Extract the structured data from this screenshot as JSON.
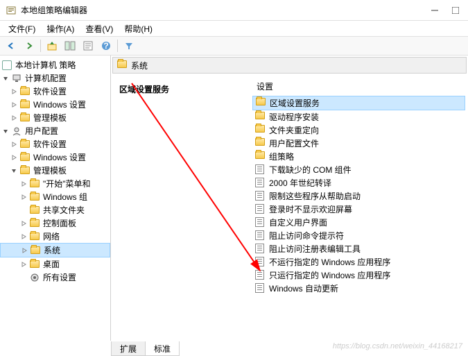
{
  "window": {
    "title": "本地组策略编辑器"
  },
  "menu": {
    "file": "文件(F)",
    "action": "操作(A)",
    "view": "查看(V)",
    "help": "帮助(H)"
  },
  "tree": {
    "root": "本地计算机 策略",
    "computer": "计算机配置",
    "user": "用户配置",
    "software": "软件设置",
    "windows": "Windows 设置",
    "admin": "管理模板",
    "startmenu": "\"开始\"菜单和",
    "wincomp": "Windows 组",
    "sharedfolder": "共享文件夹",
    "controlpanel": "控制面板",
    "network": "网络",
    "system": "系统",
    "desktop": "桌面",
    "allsettings": "所有设置"
  },
  "path": {
    "current": "系统"
  },
  "detail": {
    "heading": "区域设置服务",
    "column": "设置"
  },
  "settings": [
    {
      "label": "区域设置服务",
      "type": "folder",
      "selected": true
    },
    {
      "label": "驱动程序安装",
      "type": "folder"
    },
    {
      "label": "文件夹重定向",
      "type": "folder"
    },
    {
      "label": "用户配置文件",
      "type": "folder"
    },
    {
      "label": "组策略",
      "type": "folder"
    },
    {
      "label": "下载缺少的 COM 组件",
      "type": "policy"
    },
    {
      "label": "2000 年世纪转译",
      "type": "policy"
    },
    {
      "label": "限制这些程序从帮助启动",
      "type": "policy"
    },
    {
      "label": "登录时不显示欢迎屏幕",
      "type": "policy"
    },
    {
      "label": "自定义用户界面",
      "type": "policy"
    },
    {
      "label": "阻止访问命令提示符",
      "type": "policy"
    },
    {
      "label": "阻止访问注册表编辑工具",
      "type": "policy"
    },
    {
      "label": "不运行指定的 Windows 应用程序",
      "type": "policy"
    },
    {
      "label": "只运行指定的 Windows 应用程序",
      "type": "policy"
    },
    {
      "label": "Windows 自动更新",
      "type": "policy"
    }
  ],
  "tabs": {
    "extended": "扩展",
    "standard": "标准"
  },
  "watermark": "https://blog.csdn.net/weixin_44168217"
}
